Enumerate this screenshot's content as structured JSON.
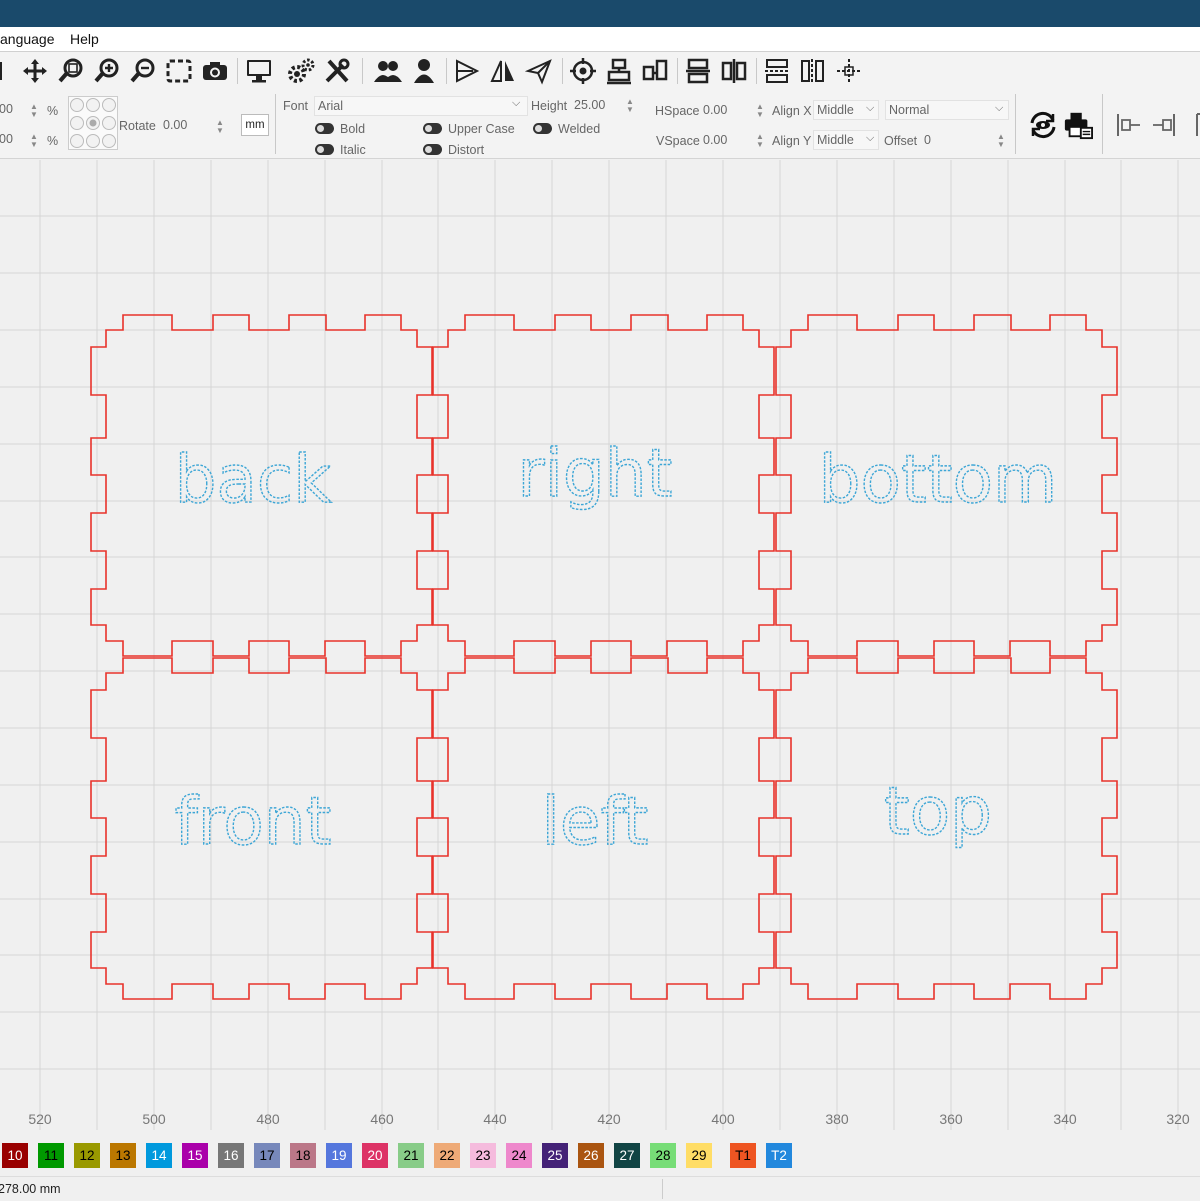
{
  "menu": {
    "items": [
      "anguage",
      "Help"
    ]
  },
  "props": {
    "scale_x_value": "00",
    "scale_y_value": "00",
    "percent": "%",
    "rotate_label": "Rotate",
    "rotate_value": "0.00",
    "unit_button": "mm",
    "font_label": "Font",
    "font_value": "Arial",
    "height_label": "Height",
    "height_value": "25.00",
    "bold": "Bold",
    "italic": "Italic",
    "upper_case": "Upper Case",
    "welded": "Welded",
    "distort": "Distort",
    "hspace_label": "HSpace",
    "hspace_value": "0.00",
    "vspace_label": "VSpace",
    "vspace_value": "0.00",
    "align_x_label": "Align X",
    "align_x_value": "Middle",
    "align_y_label": "Align Y",
    "align_y_value": "Middle",
    "mode_value": "Normal",
    "offset_label": "Offset",
    "offset_value": "0"
  },
  "ruler": {
    "labels": [
      "520",
      "500",
      "480",
      "460",
      "440",
      "420",
      "400",
      "380",
      "360",
      "340",
      "320"
    ]
  },
  "panels": [
    "back",
    "right",
    "bottom",
    "front",
    "left",
    "top"
  ],
  "palette": [
    {
      "label": "10",
      "color": "#990000",
      "text": "#ffffff"
    },
    {
      "label": "11",
      "color": "#009900",
      "text": "#000000"
    },
    {
      "label": "12",
      "color": "#999900",
      "text": "#000000"
    },
    {
      "label": "13",
      "color": "#bb7700",
      "text": "#000000"
    },
    {
      "label": "14",
      "color": "#0099dd",
      "text": "#ffffff"
    },
    {
      "label": "15",
      "color": "#aa00aa",
      "text": "#ffffff"
    },
    {
      "label": "16",
      "color": "#777777",
      "text": "#ffffff"
    },
    {
      "label": "17",
      "color": "#7788bb",
      "text": "#000000"
    },
    {
      "label": "18",
      "color": "#bb7788",
      "text": "#000000"
    },
    {
      "label": "19",
      "color": "#5577dd",
      "text": "#ffffff"
    },
    {
      "label": "20",
      "color": "#dd3366",
      "text": "#ffffff"
    },
    {
      "label": "21",
      "color": "#88cc88",
      "text": "#000000"
    },
    {
      "label": "22",
      "color": "#eeaa77",
      "text": "#000000"
    },
    {
      "label": "23",
      "color": "#f5bbdd",
      "text": "#000000"
    },
    {
      "label": "24",
      "color": "#ee88cc",
      "text": "#000000"
    },
    {
      "label": "25",
      "color": "#442277",
      "text": "#ffffff"
    },
    {
      "label": "26",
      "color": "#aa5511",
      "text": "#ffffff"
    },
    {
      "label": "27",
      "color": "#114444",
      "text": "#ffffff"
    },
    {
      "label": "28",
      "color": "#77dd77",
      "text": "#000000"
    },
    {
      "label": "29",
      "color": "#ffdd66",
      "text": "#000000"
    },
    {
      "label": "T1",
      "color": "#ee5522",
      "text": "#000000"
    },
    {
      "label": "T2",
      "color": "#2288dd",
      "text": "#ffffff"
    }
  ],
  "status": {
    "coordinate": "278.00 mm"
  },
  "colors": {
    "titlebar": "#1a4a6b",
    "cut_line": "#e8322b",
    "text_outline": "#3da6d6"
  }
}
